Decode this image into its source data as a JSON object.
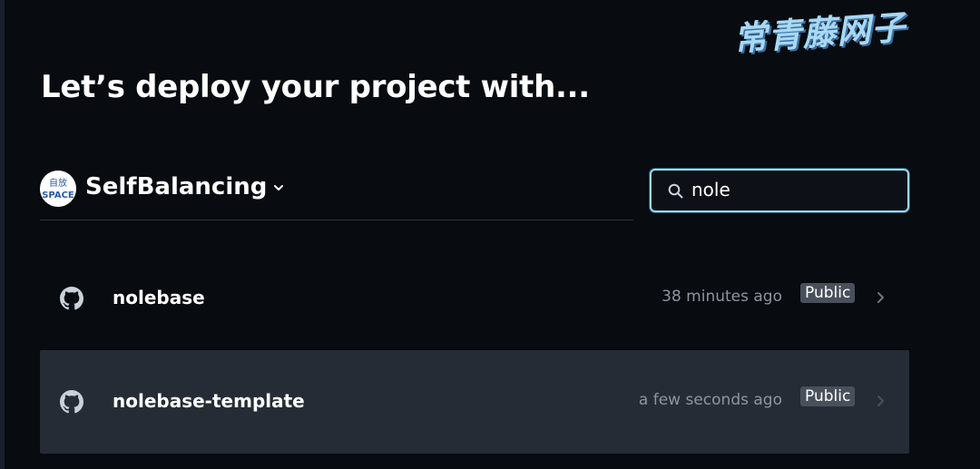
{
  "watermark": "常青藤网子",
  "page": {
    "title": "Let’s deploy your project with..."
  },
  "scope": {
    "account_name": "SelfBalancing",
    "avatar_text_top": "自放",
    "avatar_text_bottom": "SPACE",
    "chevron_icon": "chevron-down-icon"
  },
  "search": {
    "value": "nole",
    "icon": "search-icon"
  },
  "repos": [
    {
      "name": "nolebase",
      "time": "38 minutes ago",
      "visibility": "Public",
      "icon": "github-icon"
    },
    {
      "name": "nolebase-template",
      "time": "a few seconds ago",
      "visibility": "Public",
      "icon": "github-icon"
    }
  ],
  "colors": {
    "background": "#080b10",
    "row_hover": "#262c36",
    "search_focus_border": "#9bdaf0",
    "badge_bg": "#4a505b",
    "muted_text": "#8d96a0"
  }
}
